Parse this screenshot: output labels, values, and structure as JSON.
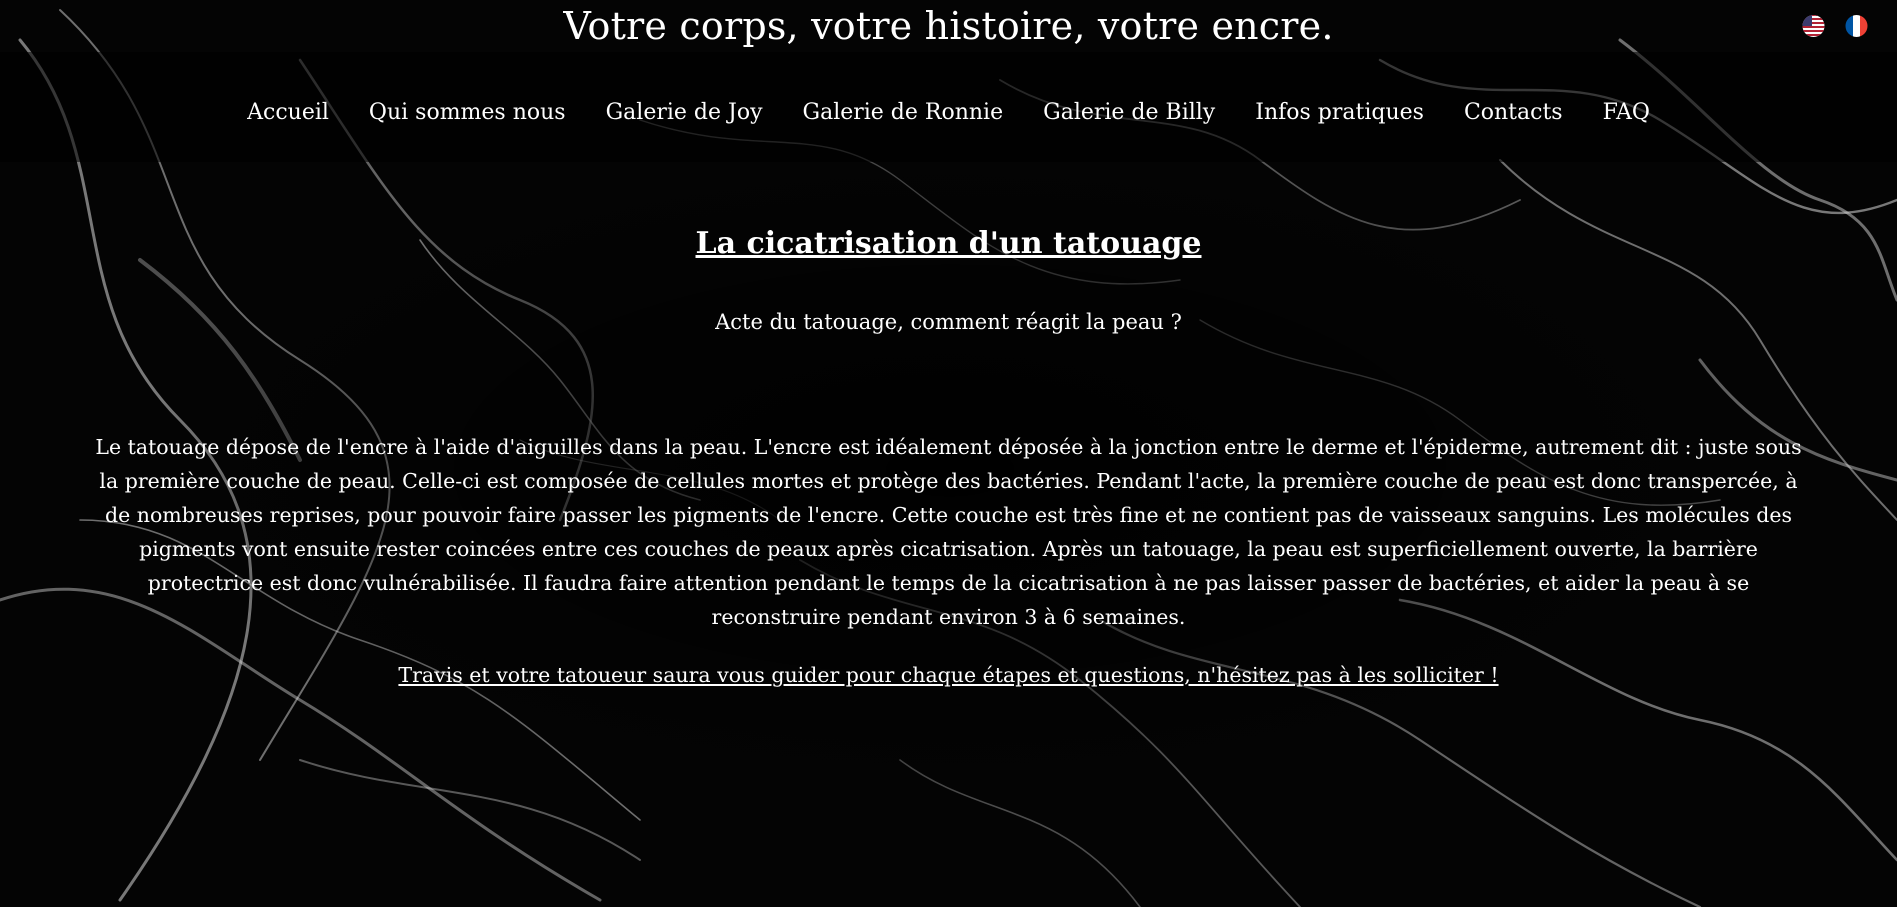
{
  "header": {
    "site_title": "Votre corps, votre histoire, votre encre.",
    "flags": [
      {
        "icon": "us-flag-icon",
        "colors": [
          "#b22234",
          "#ffffff",
          "#3c3b6e"
        ]
      },
      {
        "icon": "fr-flag-icon",
        "colors": [
          "#0055a4",
          "#ffffff",
          "#ef4135"
        ]
      }
    ]
  },
  "nav": {
    "items": [
      {
        "label": "Accueil"
      },
      {
        "label": "Qui sommes nous"
      },
      {
        "label": "Galerie de Joy"
      },
      {
        "label": "Galerie de Ronnie"
      },
      {
        "label": "Galerie de Billy"
      },
      {
        "label": "Infos pratiques"
      },
      {
        "label": "Contacts"
      },
      {
        "label": "FAQ"
      }
    ]
  },
  "main": {
    "heading": "La cicatrisation d'un tatouage",
    "subheading": "Acte du tatouage, comment réagit la peau ?",
    "paragraph": "Le tatouage dépose de l'encre à l'aide d'aiguilles dans la peau. L'encre est idéalement déposée à la jonction entre le derme et l'épiderme, autrement dit : juste sous la première couche de peau. Celle-ci est composée de cellules mortes et protège des bactéries. Pendant l'acte, la première couche de peau est donc transpercée, à de nombreuses reprises, pour pouvoir faire passer les pigments de l'encre. Cette couche est très fine et ne contient pas de vaisseaux sanguins. Les molécules des pigments vont ensuite rester coincées entre ces couches de peaux après cicatrisation. Après un tatouage, la peau est superficiellement ouverte, la barrière protectrice est donc vulnérabilisée. Il faudra faire attention pendant le temps de la cicatrisation à ne pas laisser passer de bactéries, et aider la peau à se reconstruire pendant environ 3 à 6 semaines.",
    "cta_link": "Travis et votre tatoueur saura vous guider pour chaque étapes et questions, n'hésitez pas à les solliciter !"
  },
  "theme": {
    "background": "#000000",
    "text": "#ffffff"
  }
}
